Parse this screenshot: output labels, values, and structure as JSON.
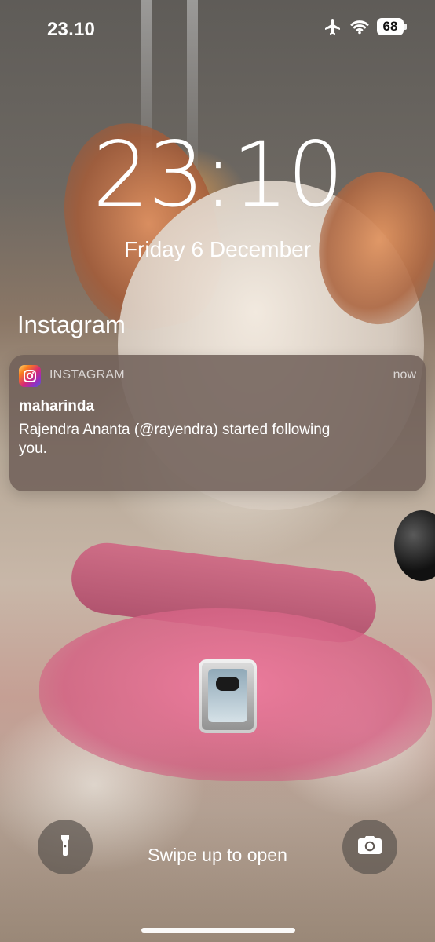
{
  "status_bar": {
    "time": "23.10",
    "battery": "68"
  },
  "lockscreen": {
    "clock": "23:10",
    "date": "Friday 6 December",
    "group_title": "Instagram",
    "swipe_text": "Swipe up to open"
  },
  "notification": {
    "app_name": "INSTAGRAM",
    "time": "now",
    "title": "maharinda",
    "body": "Rajendra Ananta (@rayendra) started following you."
  },
  "icons": {
    "airplane": "airplane-icon",
    "wifi": "wifi-icon",
    "battery": "battery-icon",
    "instagram": "instagram-icon",
    "flashlight": "flashlight-icon",
    "camera": "camera-icon"
  }
}
